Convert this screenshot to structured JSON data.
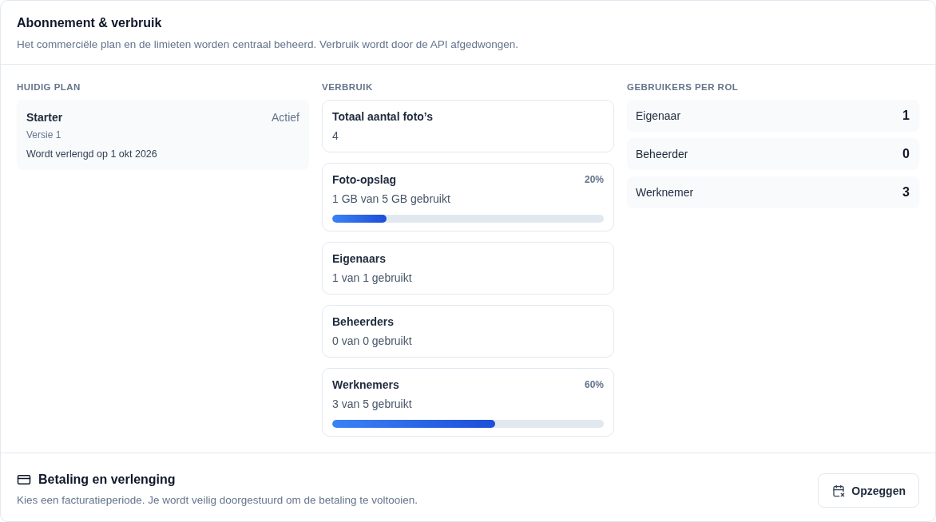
{
  "header": {
    "title": "Abonnement & verbruik",
    "description": "Het commerciële plan en de limieten worden centraal beheerd. Verbruik wordt door de API afgedwongen."
  },
  "plan": {
    "heading": "HUIDIG PLAN",
    "name": "Starter",
    "status": "Actief",
    "version": "Versie 1",
    "renewal": "Wordt verlengd op 1 okt 2026"
  },
  "usage": {
    "heading": "VERBRUIK",
    "items": [
      {
        "kind": "stat",
        "label": "Totaal aantal foto’s",
        "value": "4"
      },
      {
        "kind": "meter",
        "label": "Foto-opslag",
        "value": "1 GB van 5 GB gebruikt",
        "percent": "20%",
        "level": 0.2
      },
      {
        "kind": "stat",
        "label": "Eigenaars",
        "value": "1 van 1 gebruikt"
      },
      {
        "kind": "stat",
        "label": "Beheerders",
        "value": "0 van 0 gebruikt"
      },
      {
        "kind": "meter",
        "label": "Werknemers",
        "value": "3 van 5 gebruikt",
        "percent": "60%",
        "level": 0.6
      }
    ]
  },
  "roles": {
    "heading": "GEBRUIKERS PER ROL",
    "items": [
      {
        "name": "Eigenaar",
        "count": "1"
      },
      {
        "name": "Beheerder",
        "count": "0"
      },
      {
        "name": "Werknemer",
        "count": "3"
      }
    ]
  },
  "billing": {
    "title": "Betaling en verlenging",
    "description": "Kies een facturatieperiode. Je wordt veilig doorgestuurd om de betaling te voltooien.",
    "button": "Opzeggen"
  }
}
